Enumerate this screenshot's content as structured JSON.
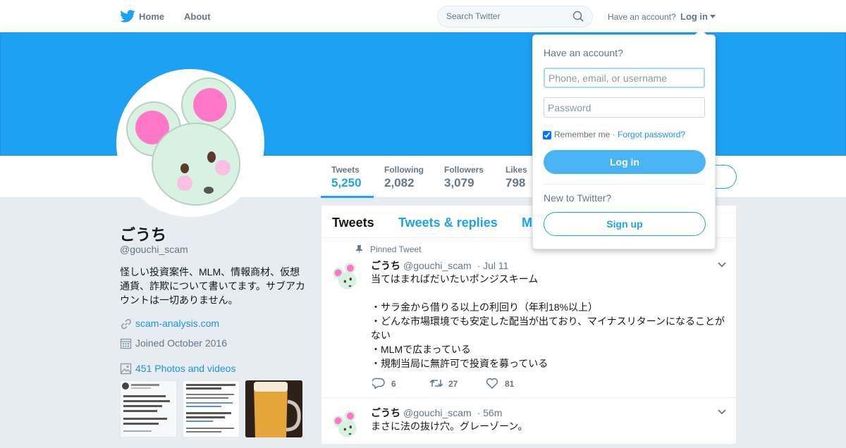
{
  "nav": {
    "home_label": "Home",
    "about_label": "About",
    "search_placeholder": "Search Twitter",
    "have_account": "Have an account?",
    "login_label": "Log in"
  },
  "colors": {
    "brand": "#1da1f2",
    "banner": "#1da1f2",
    "background": "#e6ecf0"
  },
  "profile": {
    "name": "ごうち",
    "handle": "@gouchi_scam",
    "bio": "怪しい投資案件、MLM、情報商材、仮想通貨、詐欺について書いてます。サブアカウントは一切ありません。",
    "website": "scam-analysis.com",
    "joined": "Joined October 2016",
    "media_label": "451 Photos and videos"
  },
  "stats": [
    {
      "label": "Tweets",
      "value": "5,250"
    },
    {
      "label": "Following",
      "value": "2,082"
    },
    {
      "label": "Followers",
      "value": "3,079"
    },
    {
      "label": "Likes",
      "value": "798"
    }
  ],
  "tabs": [
    {
      "label": "Tweets"
    },
    {
      "label": "Tweets & replies"
    },
    {
      "label": "M"
    }
  ],
  "tweets": [
    {
      "pinned_label": "Pinned Tweet",
      "name": "ごうち",
      "handle": "@gouchi_scam",
      "time": "· Jul 11",
      "text": "当てはまればだいたいポンジスキーム\n\n・サラ金から借りる以上の利回り（年利18%以上）\n・どんな市場環境でも安定した配当が出ており、マイナスリターンになることがない\n・MLMで広まっている\n・規制当局に無許可で投資を募っている",
      "replies": "6",
      "retweets": "27",
      "likes": "81"
    },
    {
      "name": "ごうち",
      "handle": "@gouchi_scam",
      "time": "· 56m",
      "text": "まさに法の抜け穴。グレーゾーン。"
    }
  ],
  "login_dropdown": {
    "title": "Have an account?",
    "username_placeholder": "Phone, email, or username",
    "password_placeholder": "Password",
    "remember_label": "Remember me",
    "separator_dot": "·",
    "forgot_label": "Forgot password?",
    "login_button": "Log in",
    "new_label": "New to Twitter?",
    "signup_button": "Sign up"
  }
}
